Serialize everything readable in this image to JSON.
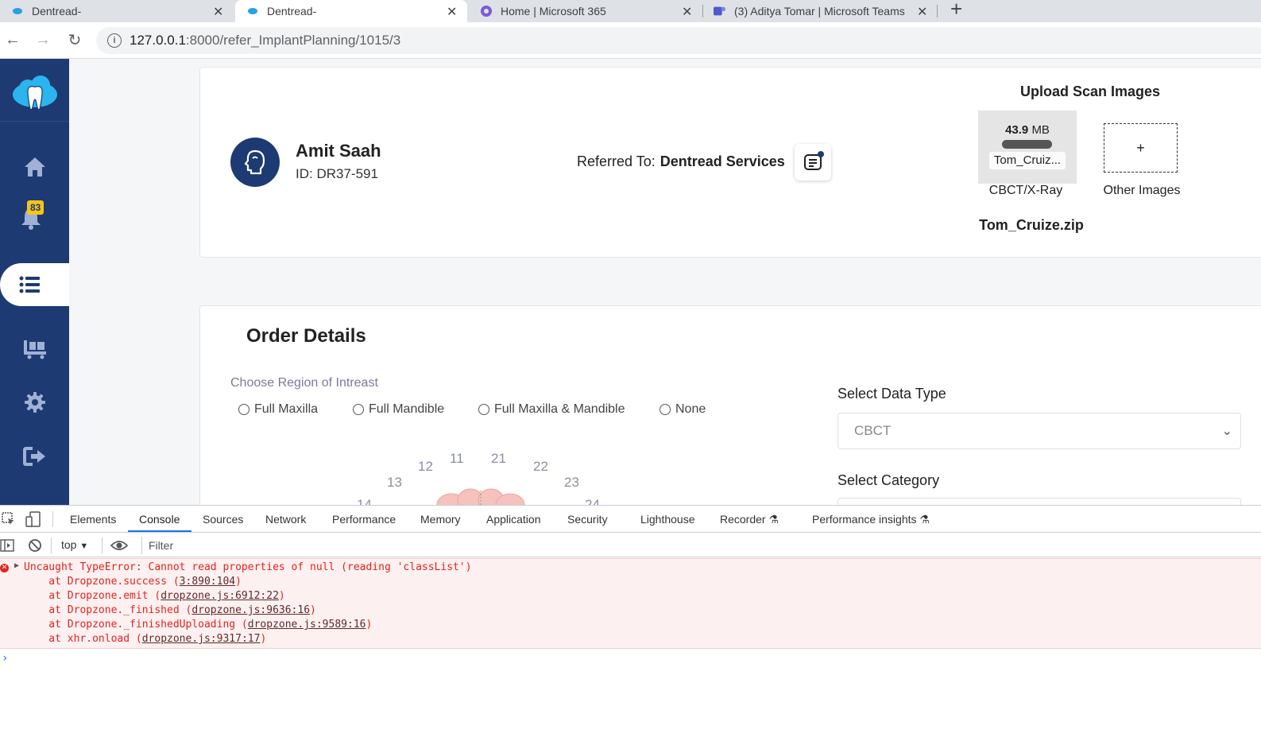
{
  "browser": {
    "tabs": [
      {
        "title": "Dentread-",
        "active": false
      },
      {
        "title": "Dentread-",
        "active": true
      },
      {
        "title": "Home | Microsoft 365",
        "active": false
      },
      {
        "title": "(3) Aditya Tomar | Microsoft Teams",
        "active": false
      }
    ],
    "new_tab_label": "+",
    "url_host": "127.0.0.1",
    "url_rest": ":8000/refer_ImplantPlanning/1015/3"
  },
  "sidebar": {
    "notification_count": "83",
    "items": [
      "home-icon",
      "bell-icon",
      "list-icon",
      "cart-icon",
      "gear-icon",
      "logout-icon"
    ]
  },
  "patient": {
    "name": "Amit Saah",
    "id": "ID: DR37-591",
    "referred_to_label": "Referred To:",
    "referred_to_value": "Dentread Services"
  },
  "upload": {
    "title": "Upload Scan Images",
    "file_size": "43.9 MB",
    "file_size_num": "43.9",
    "file_size_unit": "MB",
    "file_name_short": "Tom_Cruiz...",
    "cbct_caption": "CBCT/X-Ray",
    "other_plus": "+",
    "other_caption": "Other Images",
    "zip_name": "Tom_Cruize.zip"
  },
  "order": {
    "heading": "Order Details",
    "region_label": "Choose Region of Intreast",
    "regions": [
      "Full Maxilla",
      "Full Mandible",
      "Full Maxilla & Mandible",
      "None"
    ],
    "teeth": [
      "12",
      "11",
      "21",
      "22",
      "13",
      "23",
      "14",
      "24"
    ],
    "data_type_label": "Select Data Type",
    "data_type_value": "CBCT",
    "category_label": "Select Category"
  },
  "devtools": {
    "tabs": [
      "Elements",
      "Console",
      "Sources",
      "Network",
      "Performance",
      "Memory",
      "Application",
      "Security",
      "Lighthouse",
      "Recorder",
      "Performance insights"
    ],
    "context": "top",
    "filter_placeholder": "Filter",
    "error": {
      "message": "Uncaught TypeError: Cannot read properties of null (reading 'classList')",
      "stack": [
        {
          "prefix": "    at Dropzone.success (",
          "link": "3:890:104",
          "suffix": ")"
        },
        {
          "prefix": "    at Dropzone.emit (",
          "link": "dropzone.js:6912:22",
          "suffix": ")"
        },
        {
          "prefix": "    at Dropzone._finished (",
          "link": "dropzone.js:9636:16",
          "suffix": ")"
        },
        {
          "prefix": "    at Dropzone._finishedUploading (",
          "link": "dropzone.js:9589:16",
          "suffix": ")"
        },
        {
          "prefix": "    at xhr.onload (",
          "link": "dropzone.js:9317:17",
          "suffix": ")"
        }
      ]
    }
  }
}
